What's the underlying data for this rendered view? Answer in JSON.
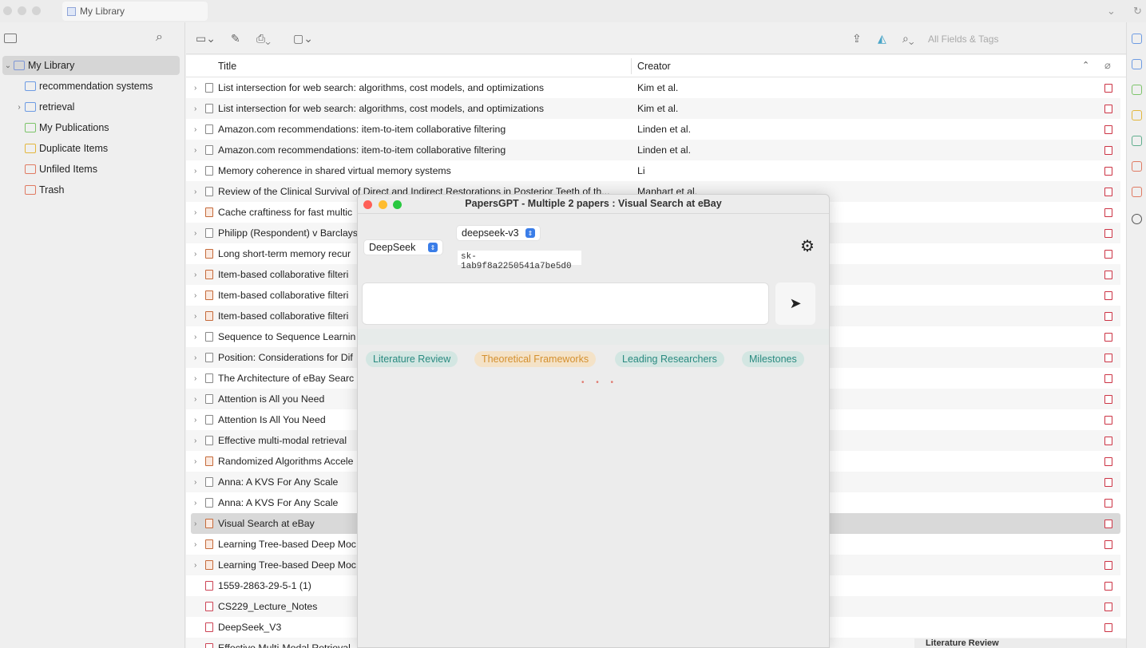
{
  "window": {
    "tab_title": "My Library"
  },
  "sidebar": {
    "items": [
      {
        "label": "My Library",
        "icon": "library-icon",
        "selected": true,
        "expanded": true,
        "indent": 0
      },
      {
        "label": "recommendation systems",
        "icon": "folder-icon",
        "indent": 1
      },
      {
        "label": "retrieval",
        "icon": "folder-icon",
        "indent": 1,
        "collapsed": true
      },
      {
        "label": "My Publications",
        "icon": "publications-icon",
        "indent": 1
      },
      {
        "label": "Duplicate Items",
        "icon": "duplicate-icon",
        "indent": 1
      },
      {
        "label": "Unfiled Items",
        "icon": "unfiled-icon",
        "indent": 1
      },
      {
        "label": "Trash",
        "icon": "trash-icon",
        "indent": 1
      }
    ]
  },
  "toolbar": {
    "search_placeholder": "All Fields & Tags"
  },
  "table": {
    "columns": {
      "title": "Title",
      "creator": "Creator"
    },
    "rows": [
      {
        "title": "List intersection for web search: algorithms, cost models, and optimizations",
        "creator": "Kim et al.",
        "type": "doc"
      },
      {
        "title": "List intersection for web search: algorithms, cost models, and optimizations",
        "creator": "Kim et al.",
        "type": "doc"
      },
      {
        "title": "Amazon.com recommendations: item-to-item collaborative filtering",
        "creator": "Linden et al.",
        "type": "doc"
      },
      {
        "title": "Amazon.com recommendations: item-to-item collaborative filtering",
        "creator": "Linden et al.",
        "type": "doc"
      },
      {
        "title": "Memory coherence in shared virtual memory systems",
        "creator": "Li",
        "type": "doc"
      },
      {
        "title": "Review of the Clinical Survival of Direct and Indirect Restorations in Posterior Teeth of th...",
        "creator": "Manhart et al.",
        "type": "doc"
      },
      {
        "title": "Cache craftiness for fast multic",
        "creator": "",
        "type": "book"
      },
      {
        "title": "Philipp (Respondent) v Barclays",
        "creator": "",
        "type": "doc"
      },
      {
        "title": "Long short-term memory recur",
        "creator": "",
        "type": "book"
      },
      {
        "title": "Item-based collaborative filteri",
        "creator": "",
        "type": "book"
      },
      {
        "title": "Item-based collaborative filteri",
        "creator": "",
        "type": "book"
      },
      {
        "title": "Item-based collaborative filteri",
        "creator": "",
        "type": "book"
      },
      {
        "title": "Sequence to Sequence Learnin",
        "creator": "",
        "type": "doc"
      },
      {
        "title": "Position: Considerations for Dif",
        "creator": "",
        "type": "doc"
      },
      {
        "title": "The Architecture of eBay Searc",
        "creator": "",
        "type": "doc"
      },
      {
        "title": "Attention is All you Need",
        "creator": "",
        "type": "doc"
      },
      {
        "title": "Attention Is All You Need",
        "creator": "",
        "type": "doc"
      },
      {
        "title": "Effective multi-modal retrieval",
        "creator": "",
        "type": "doc"
      },
      {
        "title": "Randomized Algorithms Accele",
        "creator": "",
        "type": "book"
      },
      {
        "title": "Anna: A KVS For Any Scale",
        "creator": "",
        "type": "doc"
      },
      {
        "title": "Anna: A KVS For Any Scale",
        "creator": "",
        "type": "doc"
      },
      {
        "title": "Visual Search at eBay",
        "creator": "",
        "type": "book",
        "selected": true
      },
      {
        "title": "Learning Tree-based Deep Moc",
        "creator": "",
        "type": "book"
      },
      {
        "title": "Learning Tree-based Deep Moc",
        "creator": "",
        "type": "book"
      },
      {
        "title": "1559-2863-29-5-1 (1)",
        "creator": "",
        "type": "pdf"
      },
      {
        "title": "CS229_Lecture_Notes",
        "creator": "",
        "type": "pdf"
      },
      {
        "title": "DeepSeek_V3",
        "creator": "",
        "type": "pdf"
      },
      {
        "title": "Effective Multi-Modal Retrieval",
        "creator": "",
        "type": "pdf"
      }
    ]
  },
  "dialog": {
    "title": "PapersGPT - Multiple 2 papers : Visual Search at eBay",
    "provider": "DeepSeek",
    "model": "deepseek-v3",
    "api_key": "sk-1ab9f8a2250541a7be5d0",
    "prompt_value": "",
    "chips": [
      {
        "label": "Literature Review",
        "style": "teal"
      },
      {
        "label": "Theoretical Frameworks",
        "style": "orange"
      },
      {
        "label": "Leading Researchers",
        "style": "teal"
      },
      {
        "label": "Milestones",
        "style": "teal"
      }
    ],
    "loading_indicator": "• • •"
  },
  "footer": {
    "hint": "Literature Review"
  },
  "colors": {
    "selected_row": "#d9d9d9",
    "chip_teal_text": "#2a8a80",
    "chip_orange_text": "#d4902f",
    "select_blue": "#3a7de8"
  }
}
